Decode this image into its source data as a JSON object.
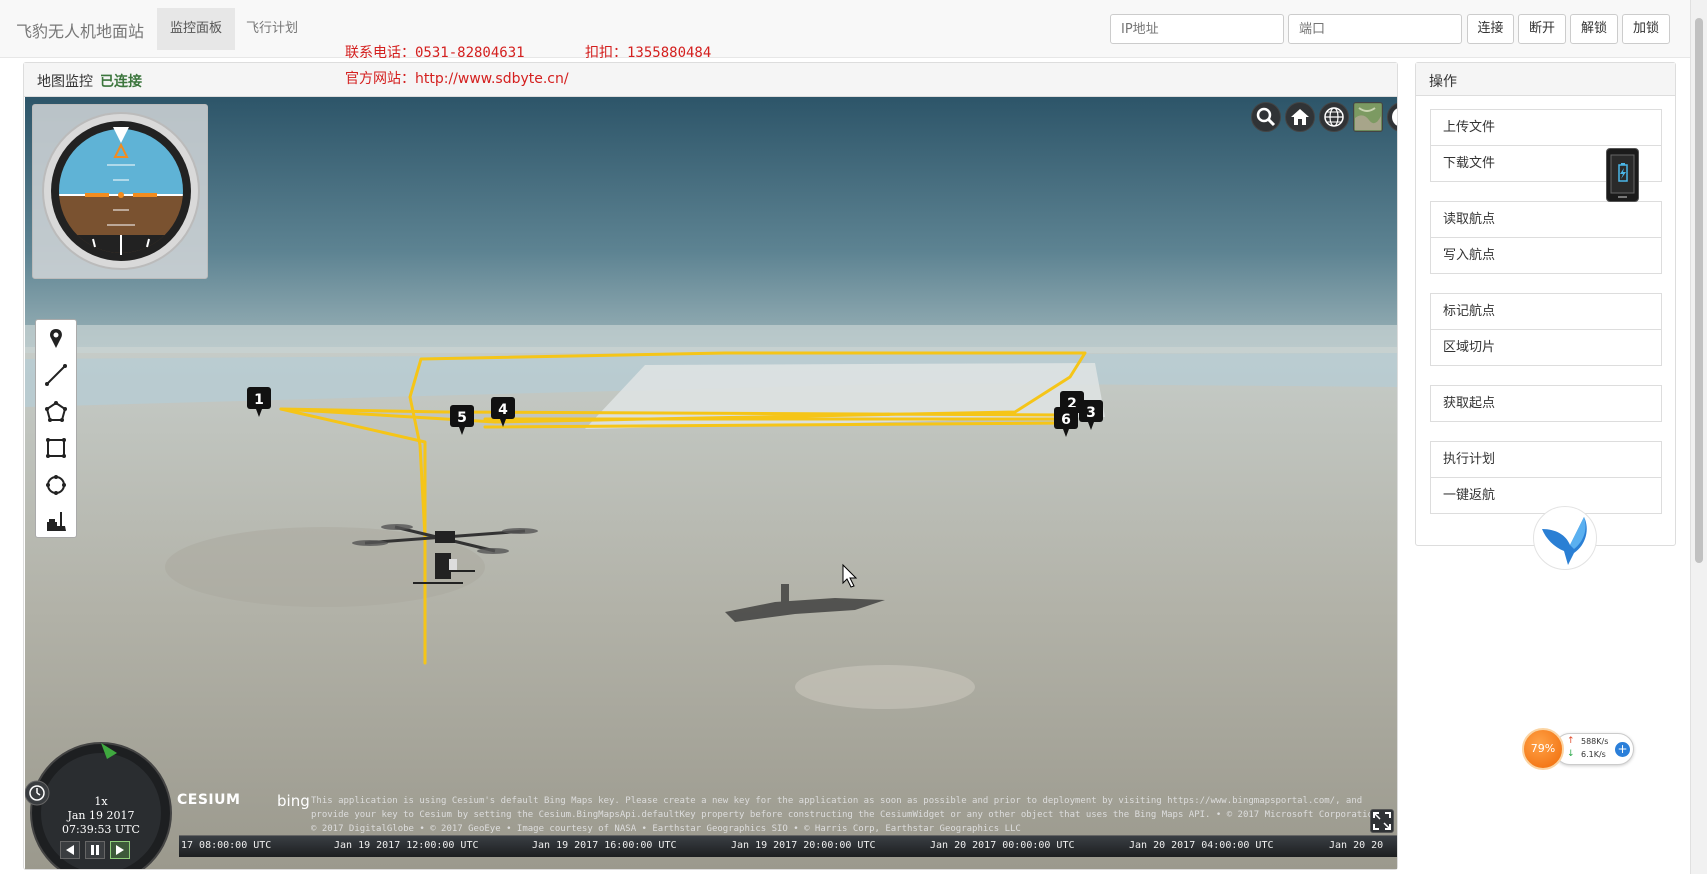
{
  "navbar": {
    "brand": "飞豹无人机地面站",
    "tabs": [
      {
        "label": "监控面板"
      },
      {
        "label": "飞行计划"
      }
    ],
    "ip_placeholder": "IP地址",
    "port_placeholder": "端口",
    "buttons": {
      "connect": "连接",
      "disconnect": "断开",
      "unlock": "解锁",
      "lock": "加锁"
    }
  },
  "contact": {
    "phone": "联系电话：0531-82804631",
    "qq": "扣扣：1355880484",
    "website": "官方网站：http://www.sdbyte.cn/"
  },
  "map_panel": {
    "title": "地图监控",
    "status": "已连接",
    "status_color": "#3c763d",
    "flight_path_color": "#f5c518",
    "waypoints": [
      "1",
      "2",
      "3",
      "4",
      "5",
      "6"
    ],
    "toolbar_icons": [
      "search-icon",
      "home-icon",
      "globe-icon",
      "layers-icon",
      "help-icon"
    ],
    "draw_tools": [
      "marker-icon",
      "polyline-icon",
      "polygon-icon",
      "rectangle-icon",
      "circle-icon",
      "clear-icon"
    ]
  },
  "clock": {
    "speed": "1x",
    "date": "Jan 19 2017",
    "time": "07:39:53 UTC"
  },
  "timeline": {
    "ticks": [
      "17 08:00:00 UTC",
      "Jan 19 2017 12:00:00 UTC",
      "Jan 19 2017 16:00:00 UTC",
      "Jan 19 2017 20:00:00 UTC",
      "Jan 20 2017 00:00:00 UTC",
      "Jan 20 2017 04:00:00 UTC",
      "Jan 20 20"
    ]
  },
  "credits": {
    "cesium": "CESIUM",
    "bing": "bing",
    "text": "This application is using Cesium's default Bing Maps key. Please create a new key for the application as soon as possible and prior to deployment by visiting https://www.bingmapsportal.com/, and provide your key to Cesium by setting the Cesium.BingMapsApi.defaultKey property before constructing the CesiumWidget or any other object that uses the Bing Maps API. • © 2017 Microsoft Corporation • © 2017 DigitalGlobe • © 2017 GeoEye • Image courtesy of NASA • Earthstar Geographics SIO • © Harris Corp, Earthstar Geographics LLC"
  },
  "ops_panel": {
    "title": "操作",
    "groups": [
      [
        "上传文件",
        "下载文件"
      ],
      [
        "读取航点",
        "写入航点"
      ],
      [
        "标记航点",
        "区域切片"
      ],
      [
        "获取起点"
      ],
      [
        "执行计划",
        "一键返航"
      ]
    ]
  },
  "speed_widget": {
    "percent": "79%",
    "up": "588K/s",
    "down": "6.1K/s"
  }
}
